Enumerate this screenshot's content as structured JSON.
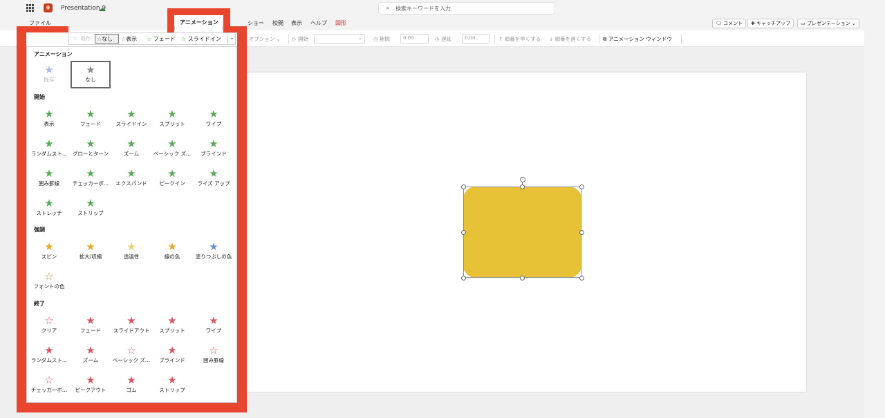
{
  "app": {
    "doc_title": "Presentation 9",
    "search_placeholder": "検索キーワードを入力"
  },
  "tabs": [
    {
      "label": "ファイル"
    },
    {
      "label": "アニメーション"
    },
    {
      "label": "ショー"
    },
    {
      "label": "校閲"
    },
    {
      "label": "表示"
    },
    {
      "label": "ヘルプ"
    },
    {
      "label": "図形"
    }
  ],
  "right_buttons": [
    {
      "label": "コメント"
    },
    {
      "label": "キャッチアップ"
    },
    {
      "label": "プレゼンテーション"
    }
  ],
  "ribbon": {
    "effect_options": "オプション",
    "start_label": "開始",
    "duration_label": "期間",
    "duration_value": "0.00",
    "delay_label": "遅延",
    "delay_value": "0.00",
    "move_earlier": "順番を早くする",
    "move_later": "順番を遅くする",
    "animation_window": "アニメーション ウィンドウ"
  },
  "gallery_strip": [
    {
      "label": "なし"
    },
    {
      "label": "表示"
    },
    {
      "label": "フェード"
    },
    {
      "label": "スライドイン"
    }
  ],
  "panel": {
    "sections": [
      {
        "title": "アニメーション",
        "items": [
          {
            "label": "既存"
          },
          {
            "label": "なし"
          }
        ]
      },
      {
        "title": "開始",
        "items": [
          {
            "label": "表示"
          },
          {
            "label": "フェード"
          },
          {
            "label": "スライドイン"
          },
          {
            "label": "スプリット"
          },
          {
            "label": "ワイプ"
          },
          {
            "label": "ランダムスト..."
          },
          {
            "label": "グローとターン"
          },
          {
            "label": "ズーム"
          },
          {
            "label": "ベーシック ズ..."
          },
          {
            "label": "ブラインド"
          },
          {
            "label": "囲み罫線"
          },
          {
            "label": "チェッカーボ..."
          },
          {
            "label": "エクスパンド"
          },
          {
            "label": "ピークイン"
          },
          {
            "label": "ライズ アップ"
          },
          {
            "label": "ストレッチ"
          },
          {
            "label": "ストリップ"
          }
        ]
      },
      {
        "title": "強調",
        "items": [
          {
            "label": "スピン"
          },
          {
            "label": "拡大/収縮"
          },
          {
            "label": "透過性"
          },
          {
            "label": "線の色"
          },
          {
            "label": "塗りつぶしの色"
          },
          {
            "label": "フォントの色"
          }
        ]
      },
      {
        "title": "終了",
        "items": [
          {
            "label": "クリア"
          },
          {
            "label": "フェード"
          },
          {
            "label": "スライドアウト"
          },
          {
            "label": "スプリット"
          },
          {
            "label": "ワイプ"
          },
          {
            "label": "ランダムスト..."
          },
          {
            "label": "ズーム"
          },
          {
            "label": "ベーシック ズ..."
          },
          {
            "label": "ブラインド"
          },
          {
            "label": "囲み罫線"
          },
          {
            "label": "チェッカーボ..."
          },
          {
            "label": "ピークアウト"
          },
          {
            "label": "ゴム"
          },
          {
            "label": "ストリップ"
          }
        ]
      }
    ]
  },
  "colors": {
    "highlight": "#e8462e",
    "shape_fill": "#e8c236",
    "entrance": "#5aa85a",
    "emphasis": "#e3ac27",
    "exit": "#d9545f"
  }
}
